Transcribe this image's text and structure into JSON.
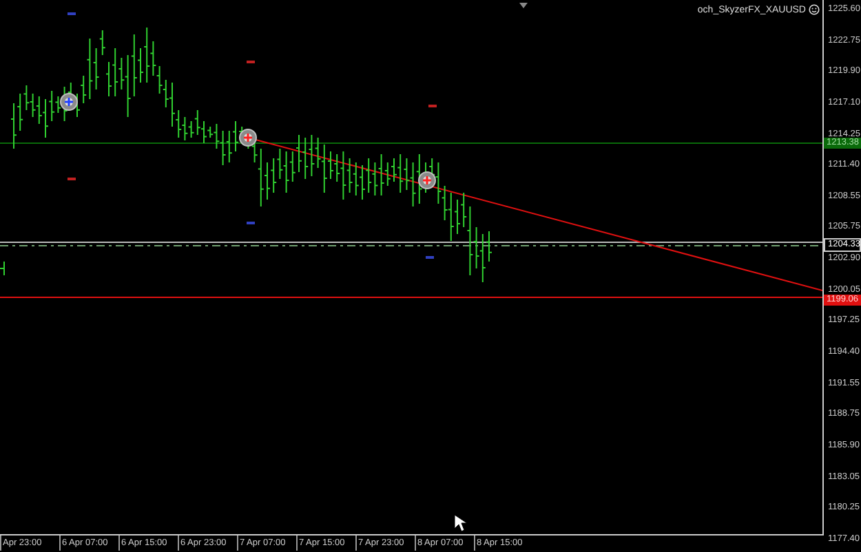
{
  "chart": {
    "title": "och_SkyzerFX_XAUUSD",
    "price_scale": [
      "1225.60",
      "1222.75",
      "1219.90",
      "1217.10",
      "1214.25",
      "1211.40",
      "1208.55",
      "1205.75",
      "1202.90",
      "1200.05",
      "1197.25",
      "1194.40",
      "1191.55",
      "1188.75",
      "1185.90",
      "1183.05",
      "1180.25",
      "1177.40"
    ],
    "time_scale": [
      "Apr 23:00",
      "6 Apr 07:00",
      "6 Apr 15:00",
      "6 Apr 23:00",
      "7 Apr 07:00",
      "7 Apr 15:00",
      "7 Apr 23:00",
      "8 Apr 07:00",
      "8 Apr 15:00"
    ],
    "price_tags": [
      {
        "kind": "line",
        "value": "1213.38"
      },
      {
        "kind": "bid",
        "value": "1204.33"
      },
      {
        "kind": "alert",
        "value": "1199.06"
      }
    ]
  }
}
